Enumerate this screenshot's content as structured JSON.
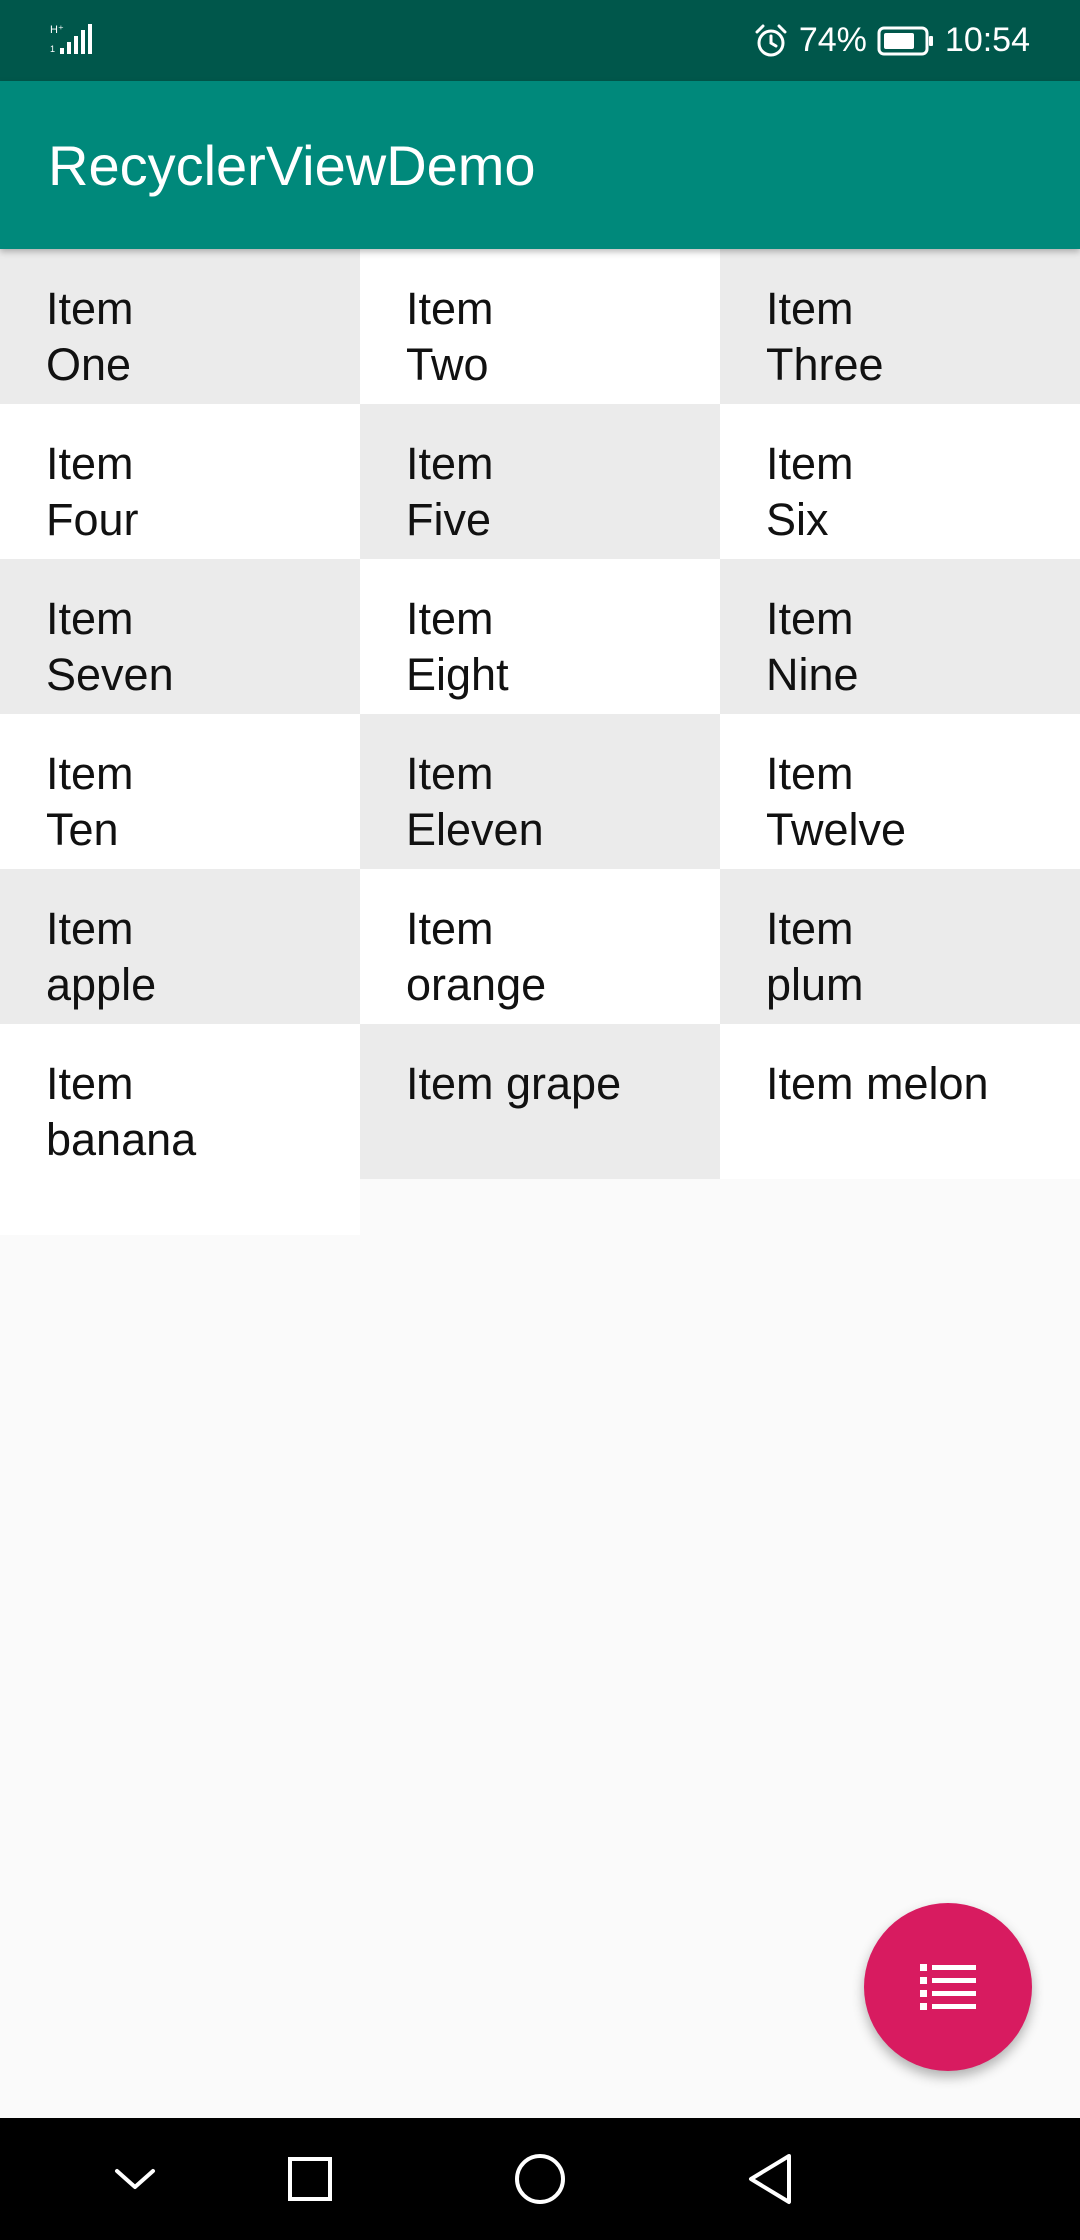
{
  "status_bar": {
    "battery": "74%",
    "time": "10:54",
    "icons": [
      "signal-icon",
      "alarm-icon",
      "battery-icon"
    ]
  },
  "app_bar": {
    "title": "RecyclerViewDemo"
  },
  "grid": {
    "items": [
      "Item One",
      "Item Two",
      "Item Three",
      "Item Four",
      "Item Five",
      "Item Six",
      "Item Seven",
      "Item Eight",
      "Item Nine",
      "Item Ten",
      "Item Eleven",
      "Item Twelve",
      "Item apple",
      "Item orange",
      "Item plum",
      "Item banana",
      "Item grape",
      "Item melon"
    ]
  },
  "fab": {
    "icon": "list-icon"
  },
  "nav_bar": {
    "icons": [
      "chevron-down-icon",
      "square-icon",
      "circle-icon",
      "back-triangle-icon"
    ]
  },
  "colors": {
    "status_bar": "#00574b",
    "app_bar": "#00897b",
    "fab": "#d81b60",
    "cell_shade": "#ebebeb",
    "cell_plain": "#ffffff"
  }
}
